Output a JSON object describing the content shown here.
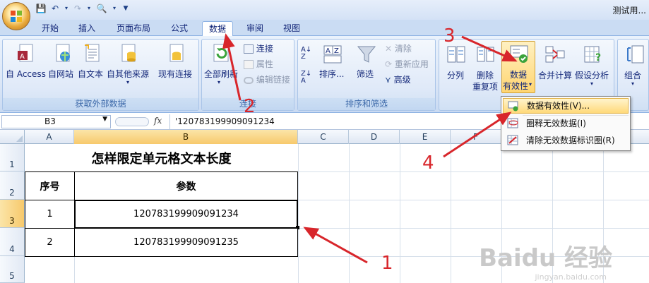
{
  "window": {
    "title": "测试用..."
  },
  "tabs": [
    {
      "label": "开始",
      "active": false
    },
    {
      "label": "插入",
      "active": false
    },
    {
      "label": "页面布局",
      "active": false
    },
    {
      "label": "公式",
      "active": false
    },
    {
      "label": "数据",
      "active": true
    },
    {
      "label": "审阅",
      "active": false
    },
    {
      "label": "视图",
      "active": false
    }
  ],
  "ribbon": {
    "get_external": {
      "label": "获取外部数据",
      "buttons": [
        "自 Access",
        "自网站",
        "自文本",
        "自其他来源",
        "现有连接"
      ]
    },
    "connections": {
      "label": "连接",
      "refresh_all": "全部刷新",
      "connect": "连接",
      "properties": "属性",
      "edit_links": "编辑链接"
    },
    "sort_filter": {
      "label": "排序和筛选",
      "sort": "排序...",
      "filter": "筛选",
      "clear": "清除",
      "reapply": "重新应用",
      "advanced": "高级"
    },
    "data_tools": {
      "split": "分列",
      "remove_dup_1": "删除",
      "remove_dup_2": "重复项",
      "validation_1": "数据",
      "validation_2": "有效性",
      "consolidate": "合并计算",
      "whatif": "假设分析"
    },
    "outline": {
      "group": "组合"
    }
  },
  "formula_bar": {
    "name_box": "B3",
    "fx": "fx",
    "formula": "'120783199909091234"
  },
  "columns": [
    "A",
    "B",
    "C",
    "D",
    "E",
    "F"
  ],
  "rows": [
    "1",
    "2",
    "3",
    "4",
    "5"
  ],
  "sheet": {
    "title": "怎样限定单元格文本长度",
    "header_seq": "序号",
    "header_param": "参数",
    "row1_seq": "1",
    "row1_param": "120783199909091234",
    "row2_seq": "2",
    "row2_param": "120783199909091235"
  },
  "dropdown_menu": [
    {
      "label": "数据有效性(V)...",
      "highlighted": true
    },
    {
      "label": "圈释无效数据(I)",
      "highlighted": false
    },
    {
      "label": "清除无效数据标识圈(R)",
      "highlighted": false
    }
  ],
  "annotations": [
    "1",
    "2",
    "3",
    "4"
  ],
  "watermark": {
    "text": "Baidu 经验",
    "sub": "jingyan.baidu.com"
  },
  "colors": {
    "arrow": "#d8262b",
    "ribbon_bg": "#dce7f7",
    "selected_header": "#f7c96c"
  }
}
